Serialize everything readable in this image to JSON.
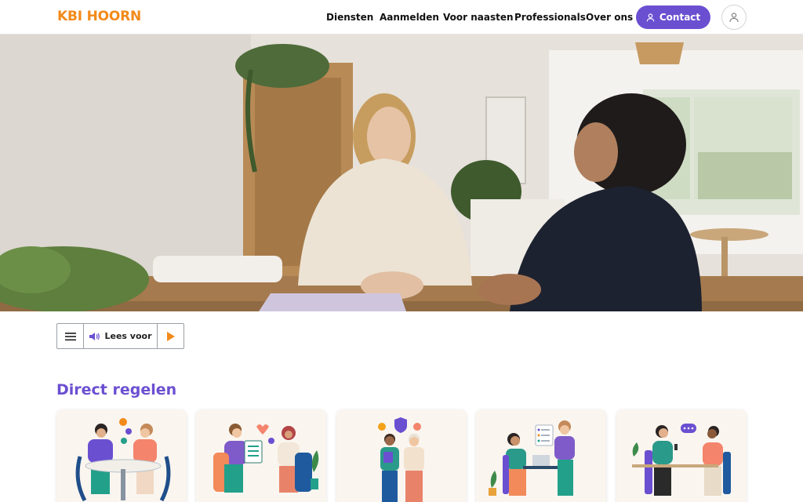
{
  "header": {
    "logo": "KBI HOORN",
    "nav": [
      "Diensten",
      "Aanmelden",
      "Voor naasten",
      "Professionals",
      "Over ons"
    ],
    "contact_label": "Contact"
  },
  "reader": {
    "label": "Lees voor"
  },
  "section": {
    "title": "Direct regelen"
  },
  "colors": {
    "brand_orange": "#f28a1a",
    "accent_purple": "#6b4fd1"
  }
}
